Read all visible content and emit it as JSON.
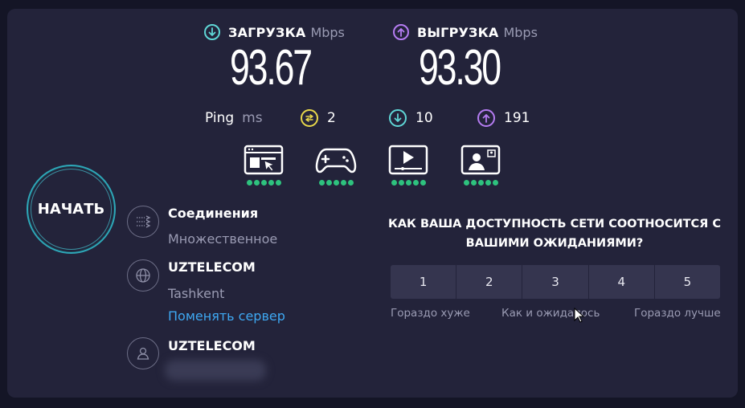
{
  "download": {
    "title": "ЗАГРУЗКА",
    "unit": "Mbps",
    "value": "93.67"
  },
  "upload": {
    "title": "ВЫГРУЗКА",
    "unit": "Mbps",
    "value": "93.30"
  },
  "ping": {
    "label": "Ping",
    "unit": "ms",
    "jitter": "2",
    "download_latency": "10",
    "upload_latency": "191"
  },
  "activities": [
    {
      "icon": "web-browsing-icon",
      "rating": 5
    },
    {
      "icon": "gaming-icon",
      "rating": 5
    },
    {
      "icon": "video-streaming-icon",
      "rating": 5
    },
    {
      "icon": "video-call-icon",
      "rating": 5
    }
  ],
  "start_button": {
    "label": "НАЧАТЬ"
  },
  "connections": {
    "title": "Соединения",
    "value": "Множественное"
  },
  "server": {
    "name": "UZTELECOM",
    "location": "Tashkent",
    "change_link": "Поменять сервер"
  },
  "provider": {
    "name": "UZTELECOM"
  },
  "rating": {
    "question": "КАК ВАША ДОСТУПНОСТЬ СЕТИ СООТНОСИТСЯ С ВАШИМИ ОЖИДАНИЯМИ?",
    "options": [
      "1",
      "2",
      "3",
      "4",
      "5"
    ],
    "label_low": "Гораздо хуже",
    "label_mid": "Как и ожидалось",
    "label_high": "Гораздо лучше"
  },
  "colors": {
    "download_accent": "#5fd6d6",
    "upload_accent": "#b57cf2",
    "jitter_accent": "#e8d84a",
    "good_dot": "#2ec27e",
    "link": "#3ea8f2"
  }
}
